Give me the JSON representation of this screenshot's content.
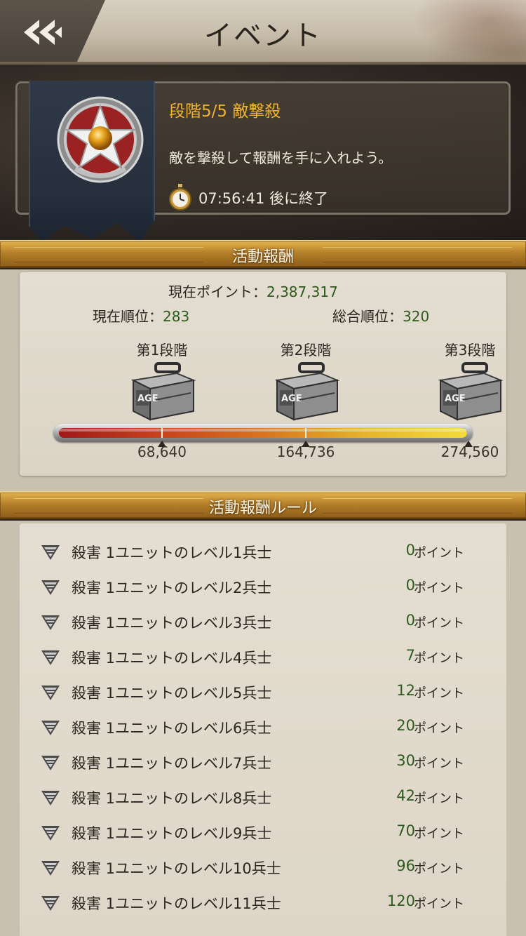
{
  "header": {
    "title": "イベント"
  },
  "event": {
    "name": "段階5/5 敵撃殺",
    "description": "敵を撃殺して報酬を手に入れよう。",
    "timer": "07:56:41 後に終了"
  },
  "rewards": {
    "section_title": "活動報酬",
    "current_points_label": "現在ポイント：",
    "current_points": "2,387,317",
    "current_rank_label": "現在順位：",
    "current_rank": "283",
    "overall_rank_label": "総合順位：",
    "overall_rank": "320",
    "stages": [
      {
        "label": "第1段階",
        "threshold": "68,640"
      },
      {
        "label": "第2段階",
        "threshold": "164,736"
      },
      {
        "label": "第3段階",
        "threshold": "274,560"
      }
    ],
    "progress_fraction": 1.0
  },
  "rules": {
    "section_title": "活動報酬ルール",
    "point_unit": "ポイント",
    "items": [
      {
        "text": "殺害 1ユニットのレベル1兵士",
        "points": "0"
      },
      {
        "text": "殺害 1ユニットのレベル2兵士",
        "points": "0"
      },
      {
        "text": "殺害 1ユニットのレベル3兵士",
        "points": "0"
      },
      {
        "text": "殺害 1ユニットのレベル4兵士",
        "points": "7"
      },
      {
        "text": "殺害 1ユニットのレベル5兵士",
        "points": "12"
      },
      {
        "text": "殺害 1ユニットのレベル6兵士",
        "points": "20"
      },
      {
        "text": "殺害 1ユニットのレベル7兵士",
        "points": "30"
      },
      {
        "text": "殺害 1ユニットのレベル8兵士",
        "points": "42"
      },
      {
        "text": "殺害 1ユニットのレベル9兵士",
        "points": "70"
      },
      {
        "text": "殺害 1ユニットのレベル10兵士",
        "points": "96"
      },
      {
        "text": "殺害 1ユニットのレベル11兵士",
        "points": "120"
      }
    ]
  },
  "icons": {
    "back": "double-chevron-left-icon",
    "medal": "star-medal-icon",
    "timer": "stopwatch-icon",
    "crate": "reward-crate-icon",
    "rank": "rank-chevron-icon"
  },
  "colors": {
    "event_name": "#f0b232",
    "points_value": "#2f5a1d",
    "section_bar": "#b5802a"
  }
}
